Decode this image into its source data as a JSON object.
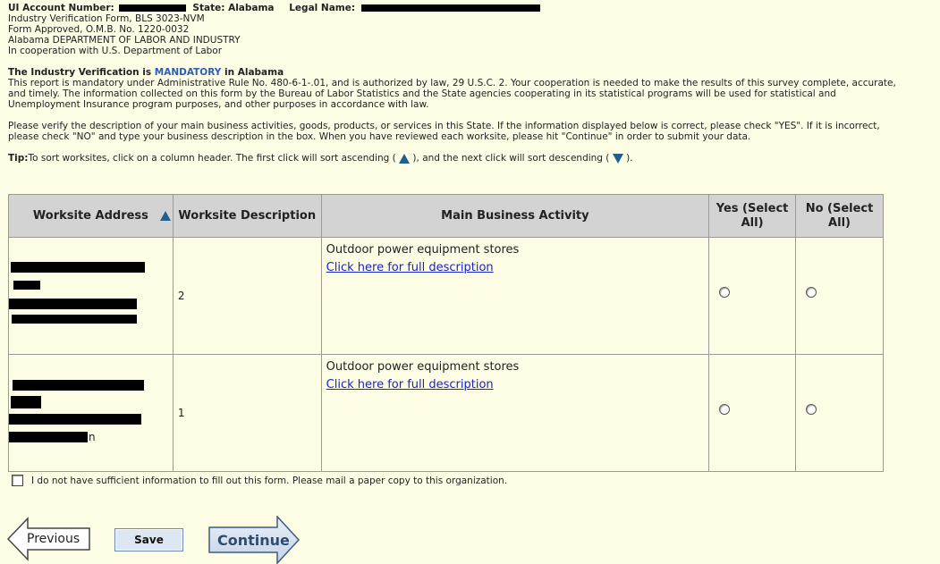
{
  "header": {
    "ui_account_label": "UI Account Number:",
    "state_label": "State: Alabama",
    "legal_name_label": "Legal Name:",
    "form_lines": [
      "Industry Verification Form, BLS 3023-NVM",
      "Form Approved, O.M.B. No. 1220-0032",
      "Alabama DEPARTMENT OF LABOR AND INDUSTRY",
      "In cooperation with U.S. Department of Labor"
    ]
  },
  "mandatory": {
    "prefix": "The Industry Verification is ",
    "word": "MANDATORY",
    "suffix": " in Alabama",
    "text": "This report is mandatory under Administrative Rule No. 480-6-1-.01, and is authorized by law, 29 U.S.C. 2. Your cooperation is needed to make the results of this survey complete, accurate, and timely. The information collected on this form by the Bureau of Labor Statistics and the State agencies cooperating in its statistical programs will be used for statistical and Unemployment Insurance program purposes, and other purposes in accordance with law."
  },
  "verify_text": "Please verify the description of your main business activities, goods, products, or services in this State. If the information displayed below is correct, please check \"YES\". If it is incorrect, please check \"NO\" and type your business description in the box. When you have reviewed each worksite, please hit \"Continue\" in order to submit your data.",
  "tip": {
    "label": "Tip:",
    "text1": "To sort worksites, click on a column header. The first click will sort ascending ( ",
    "text2": " ), and the next click will sort descending ( ",
    "text3": " )."
  },
  "table": {
    "headers": {
      "address": "Worksite Address",
      "description": "Worksite Description",
      "main_activity": "Main Business Activity",
      "yes": "Yes (Select All)",
      "no": "No (Select All)"
    },
    "rows": [
      {
        "description": "2",
        "activity": "Outdoor power equipment stores",
        "link": "Click here for full description"
      },
      {
        "description": "1",
        "activity": "Outdoor power equipment stores",
        "link": "Click here for full description",
        "address_tail": "n"
      }
    ]
  },
  "checkbox_text": "I do not have sufficient information to fill out this form. Please mail a paper copy to this organization.",
  "buttons": {
    "previous": "Previous",
    "save": "Save",
    "continue": "Continue"
  }
}
